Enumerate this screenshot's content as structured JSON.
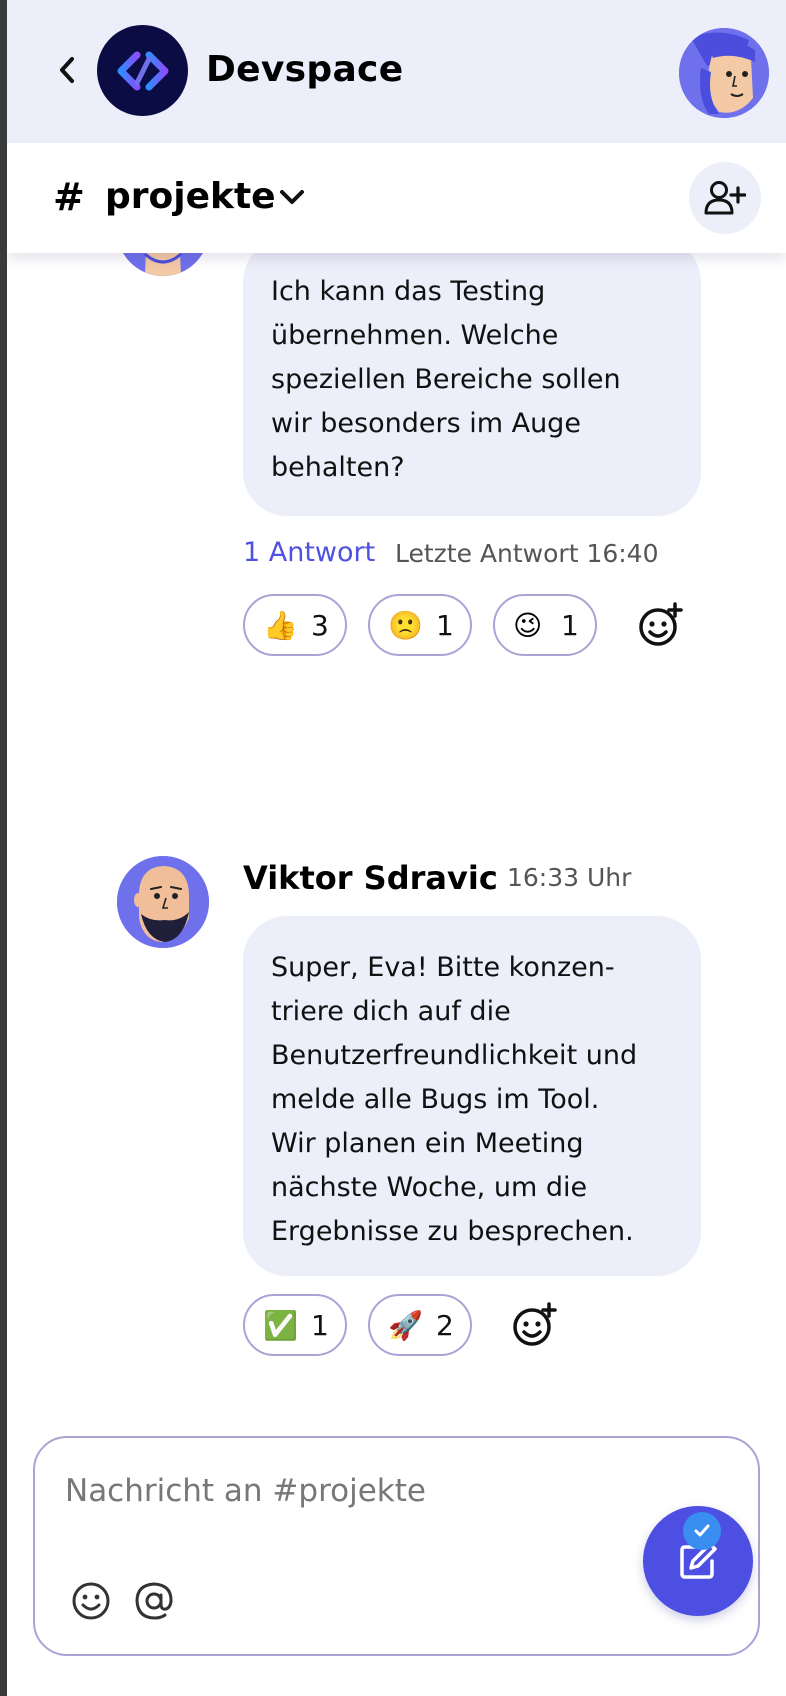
{
  "app": {
    "title": "Devspace",
    "accent_color": "#4f51e0",
    "header_bg": "#eceefa",
    "logo_bg": "#0c0c44"
  },
  "header": {
    "back_icon": "chevron-left-icon",
    "logo_icon": "devspace-logo-icon",
    "user_avatar": "user-avatar-woman"
  },
  "channel": {
    "hash": "#",
    "name": "projekte",
    "dropdown_icon": "chevron-down-icon",
    "add_member_icon": "user-plus-icon"
  },
  "messages": [
    {
      "avatar": "avatar-partial",
      "lines": [
        "Ich kann das Testing",
        "übernehmen. Welche",
        "speziellen Bereiche sollen",
        "wir besonders im Auge",
        "behalten?"
      ],
      "thread": {
        "replies": "1 Antwort",
        "last_reply": "Letzte Antwort 16:40"
      },
      "reactions": [
        {
          "emoji": "👍",
          "count": "3"
        },
        {
          "emoji": "🙁",
          "count": "1"
        },
        {
          "emoji": "😉",
          "count": "1"
        }
      ]
    },
    {
      "author": "Viktor Sdravic",
      "time": "16:33 Uhr",
      "avatar": "avatar-bearded-man",
      "lines": [
        "Super, Eva! Bitte konzen-",
        "triere dich auf die",
        "Benutzerfreundlichkeit und",
        "melde alle Bugs im Tool.",
        "Wir planen ein Meeting",
        "nächste Woche, um die",
        "Ergebnisse zu besprechen."
      ],
      "reactions": [
        {
          "emoji": "✅",
          "count": "1"
        },
        {
          "emoji": "🚀",
          "count": "2"
        }
      ]
    }
  ],
  "composer": {
    "placeholder": "Nachricht an #projekte",
    "emoji_icon": "smiley-icon",
    "mention_icon": "at-sign-icon",
    "fab_icon": "edit-icon",
    "fab_badge_icon": "check-icon"
  }
}
